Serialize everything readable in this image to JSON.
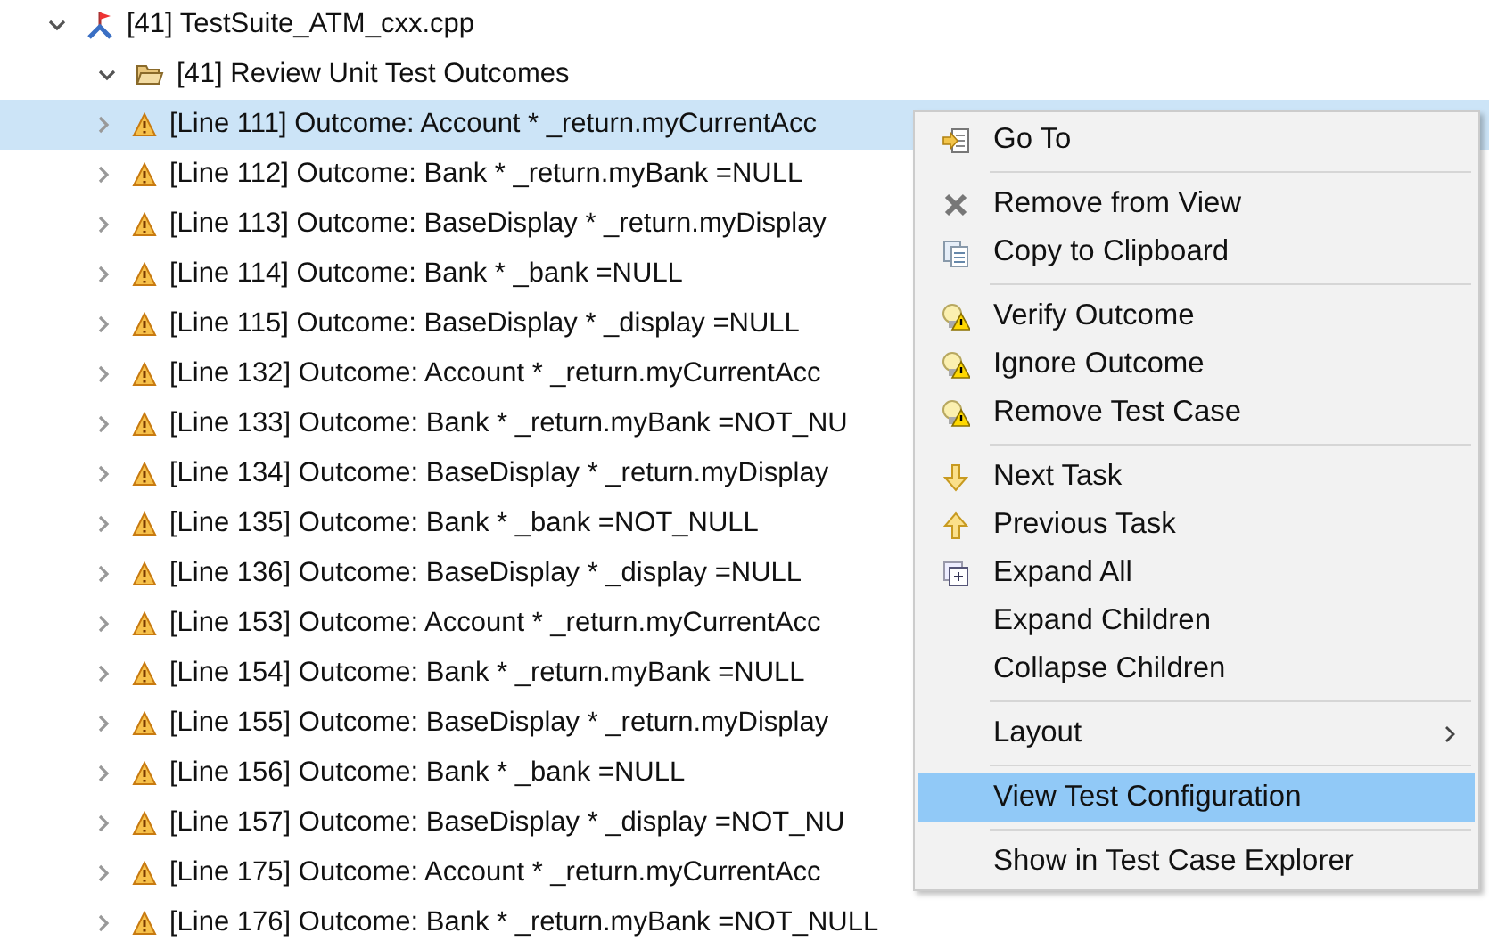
{
  "tree": {
    "label": "[41] TestSuite_ATM_cxx.cpp",
    "expanded": true,
    "children": [
      {
        "label": "[41] Review Unit Test Outcomes",
        "expanded": true,
        "children": [
          {
            "label": "[Line 111] Outcome: Account * _return.myCurrentAcc",
            "expanded": false,
            "selected": true
          },
          {
            "label": "[Line 112] Outcome: Bank * _return.myBank =NULL",
            "expanded": false,
            "selected": false
          },
          {
            "label": "[Line 113] Outcome: BaseDisplay * _return.myDisplay",
            "expanded": false,
            "selected": false
          },
          {
            "label": "[Line 114] Outcome: Bank * _bank =NULL",
            "expanded": false,
            "selected": false
          },
          {
            "label": "[Line 115] Outcome: BaseDisplay * _display =NULL",
            "expanded": false,
            "selected": false
          },
          {
            "label": "[Line 132] Outcome: Account * _return.myCurrentAcc",
            "expanded": false,
            "selected": false
          },
          {
            "label": "[Line 133] Outcome: Bank * _return.myBank =NOT_NU",
            "expanded": false,
            "selected": false
          },
          {
            "label": "[Line 134] Outcome: BaseDisplay * _return.myDisplay",
            "expanded": false,
            "selected": false
          },
          {
            "label": "[Line 135] Outcome: Bank * _bank =NOT_NULL",
            "expanded": false,
            "selected": false
          },
          {
            "label": "[Line 136] Outcome: BaseDisplay * _display =NULL",
            "expanded": false,
            "selected": false
          },
          {
            "label": "[Line 153] Outcome: Account * _return.myCurrentAcc",
            "expanded": false,
            "selected": false
          },
          {
            "label": "[Line 154] Outcome: Bank * _return.myBank =NULL",
            "expanded": false,
            "selected": false
          },
          {
            "label": "[Line 155] Outcome: BaseDisplay * _return.myDisplay",
            "expanded": false,
            "selected": false
          },
          {
            "label": "[Line 156] Outcome: Bank * _bank =NULL",
            "expanded": false,
            "selected": false
          },
          {
            "label": "[Line 157] Outcome: BaseDisplay * _display =NOT_NU",
            "expanded": false,
            "selected": false
          },
          {
            "label": "[Line 175] Outcome: Account * _return.myCurrentAcc",
            "expanded": false,
            "selected": false
          },
          {
            "label": "[Line 176] Outcome: Bank * _return.myBank =NOT_NULL",
            "expanded": false,
            "selected": false
          }
        ]
      }
    ]
  },
  "context_menu": {
    "groups": [
      [
        {
          "label": "Go To",
          "kind": "goto",
          "selected": false,
          "submenu": false
        }
      ],
      [
        {
          "label": "Remove from View",
          "kind": "remove",
          "selected": false,
          "submenu": false
        },
        {
          "label": "Copy to Clipboard",
          "kind": "copy",
          "selected": false,
          "submenu": false
        }
      ],
      [
        {
          "label": "Verify Outcome",
          "kind": "bulb",
          "selected": false,
          "submenu": false
        },
        {
          "label": "Ignore Outcome",
          "kind": "bulb",
          "selected": false,
          "submenu": false
        },
        {
          "label": "Remove Test Case",
          "kind": "bulb",
          "selected": false,
          "submenu": false
        }
      ],
      [
        {
          "label": "Next Task",
          "kind": "down",
          "selected": false,
          "submenu": false
        },
        {
          "label": "Previous Task",
          "kind": "up",
          "selected": false,
          "submenu": false
        },
        {
          "label": "Expand All",
          "kind": "expand",
          "selected": false,
          "submenu": false
        },
        {
          "label": "Expand Children",
          "kind": "none",
          "selected": false,
          "submenu": false
        },
        {
          "label": "Collapse Children",
          "kind": "none",
          "selected": false,
          "submenu": false
        }
      ],
      [
        {
          "label": "Layout",
          "kind": "none",
          "selected": false,
          "submenu": true
        }
      ],
      [
        {
          "label": "View Test Configuration",
          "kind": "none",
          "selected": true,
          "submenu": false
        }
      ],
      [
        {
          "label": "Show in Test Case Explorer",
          "kind": "none",
          "selected": false,
          "submenu": false
        }
      ]
    ]
  }
}
